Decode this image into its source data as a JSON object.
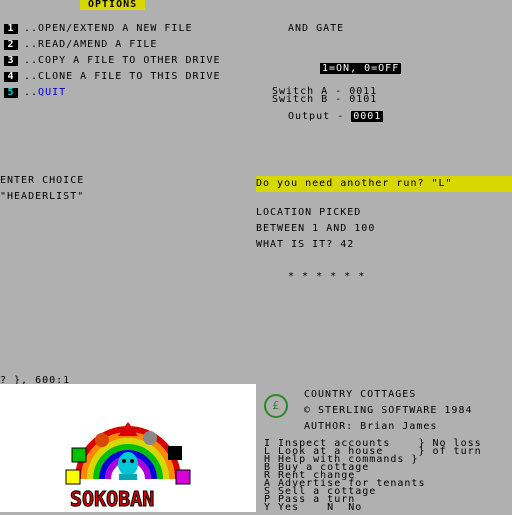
{
  "options": {
    "title": "OPTIONS",
    "items": [
      {
        "num": "1",
        "label": "..OPEN/EXTEND A NEW FILE"
      },
      {
        "num": "2",
        "label": "..READ/AMEND A FILE"
      },
      {
        "num": "3",
        "label": "..COPY A FILE TO OTHER DRIVE"
      },
      {
        "num": "4",
        "label": "..CLONE A FILE TO THIS DRIVE"
      },
      {
        "num": "5",
        "label_prefix": "..",
        "label": "QUIT"
      }
    ],
    "enter_choice": "ENTER CHOICE",
    "choice_value": "\"HEADERLIST\"",
    "error_line": "? }, 600:1"
  },
  "and_gate": {
    "title": "AND GATE",
    "legend": "1=ON, 0=OFF",
    "switch_a": "Switch A - 0011",
    "switch_b": "Switch B - 0101",
    "output_label": "Output - ",
    "output_value": "0001"
  },
  "guess_game": {
    "prompt": "Do you need another run? \"L\"",
    "line1": "LOCATION PICKED",
    "line2": "BETWEEN 1 AND 100",
    "line3": "WHAT IS IT? 42",
    "stars": "* * * * * *"
  },
  "sokoban": {
    "title": "SOKOBAN"
  },
  "country_cottages": {
    "logo": "£",
    "title": "COUNTRY COTTAGES",
    "copyright": "© STERLING SOFTWARE 1984",
    "author": "AUTHOR: Brian James",
    "menu": [
      "I Inspect accounts    } No loss",
      "L Look at a house     } of turn",
      "H Help with commands }",
      "B Buy a cottage",
      "R Rent change",
      "A Advertise for tenants",
      "S Sell a cottage",
      "P Pass a turn",
      "Y Yes    N  No"
    ]
  },
  "colors": {
    "background": "#b0b0b0",
    "yellow": "#d8d800",
    "blue": "#0000d8"
  }
}
